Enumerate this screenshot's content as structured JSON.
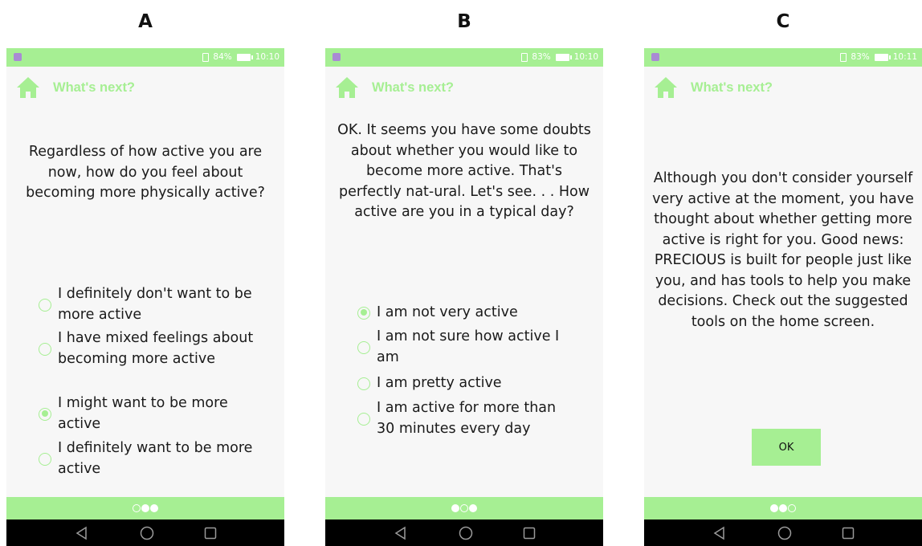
{
  "panels": [
    {
      "letter": "A",
      "status": {
        "battery": "84%",
        "time": "10:10"
      },
      "header_title": "What's next?",
      "prompt": "Regardless of how active you are now, how do you feel about becoming more physically active?",
      "options": [
        {
          "label": "I definitely don't want to be more active",
          "selected": false
        },
        {
          "label": "I have mixed feelings about becoming more active",
          "selected": false
        },
        {
          "label": "I might want to be more active",
          "selected": true
        },
        {
          "label": "I definitely want to be more active",
          "selected": false
        }
      ],
      "page_dots": [
        false,
        true,
        true
      ]
    },
    {
      "letter": "B",
      "status": {
        "battery": "83%",
        "time": "10:10"
      },
      "header_title": "What's next?",
      "prompt": "OK. It seems you have some doubts about whether you would like to become more active. That's perfectly nat-ural. Let's see. . . How active are you in a typical day?",
      "options": [
        {
          "label": "I am not very active",
          "selected": true
        },
        {
          "label": "I am not sure how active I am",
          "selected": false
        },
        {
          "label": "I am pretty active",
          "selected": false
        },
        {
          "label": "I am active for more than 30 minutes every day",
          "selected": false
        }
      ],
      "page_dots": [
        true,
        false,
        true
      ]
    },
    {
      "letter": "C",
      "status": {
        "battery": "83%",
        "time": "10:11"
      },
      "header_title": "What's next?",
      "prompt": "Although you don't consider yourself very active at the moment, you have thought about whether getting more active is right for you. Good news: PRECIOUS is built for people just like you, and has tools to help you make decisions. Check out the suggested tools on the home screen.",
      "button_label": "OK",
      "page_dots": [
        true,
        true,
        false
      ]
    }
  ],
  "colors": {
    "accent": "#a6ef93",
    "screen_bg": "#f7f7f7",
    "nav_bar": "#000000",
    "notification": "#a98ad4"
  },
  "icons": {
    "header": "home-icon",
    "nav": [
      "back-icon",
      "home-circle-icon",
      "recent-apps-icon"
    ]
  }
}
